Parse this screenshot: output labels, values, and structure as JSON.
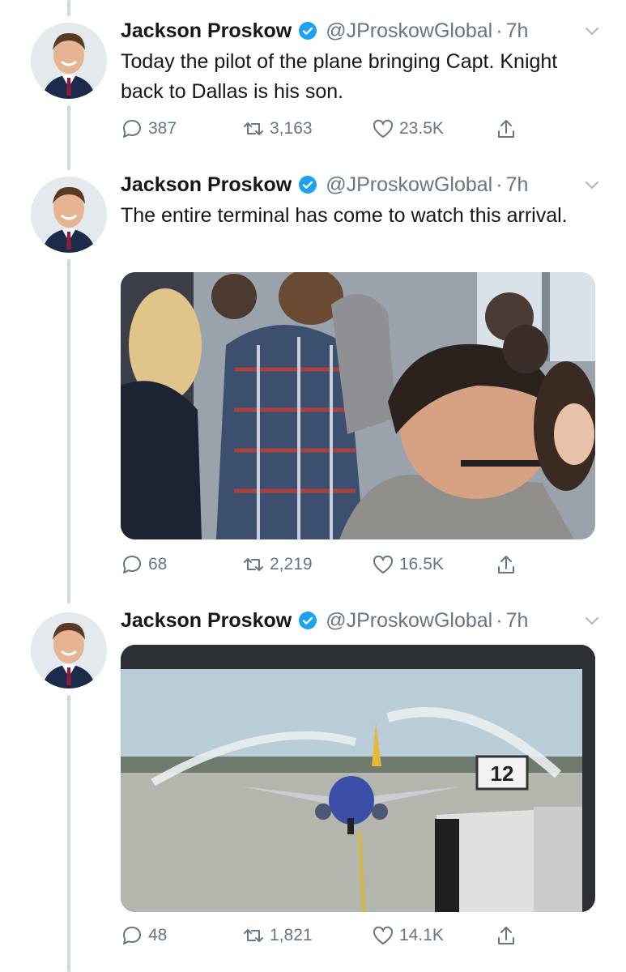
{
  "tweets": [
    {
      "author_name": "Jackson Proskow",
      "handle": "@JProskowGlobal",
      "separator": "·",
      "time": "7h",
      "text": "Today the pilot of the plane bringing Capt. Knight back to Dallas is his son.",
      "replies": "387",
      "retweets": "3,163",
      "likes": "23.5K"
    },
    {
      "author_name": "Jackson Proskow",
      "handle": "@JProskowGlobal",
      "separator": "·",
      "time": "7h",
      "text": "The entire terminal has come to watch this arrival.",
      "replies": "68",
      "retweets": "2,219",
      "likes": "16.5K"
    },
    {
      "author_name": "Jackson Proskow",
      "handle": "@JProskowGlobal",
      "separator": "·",
      "time": "7h",
      "text": "",
      "replies": "48",
      "retweets": "1,821",
      "likes": "14.1K"
    }
  ],
  "photo2_sign": "12",
  "icons": {
    "verified": "verified-badge-icon",
    "caret": "chevron-down-icon",
    "reply": "reply-icon",
    "retweet": "retweet-icon",
    "like": "heart-icon",
    "share": "share-icon"
  },
  "colors": {
    "accent": "#1da1f2",
    "muted": "#657786",
    "thread_line": "#cfd9de"
  }
}
